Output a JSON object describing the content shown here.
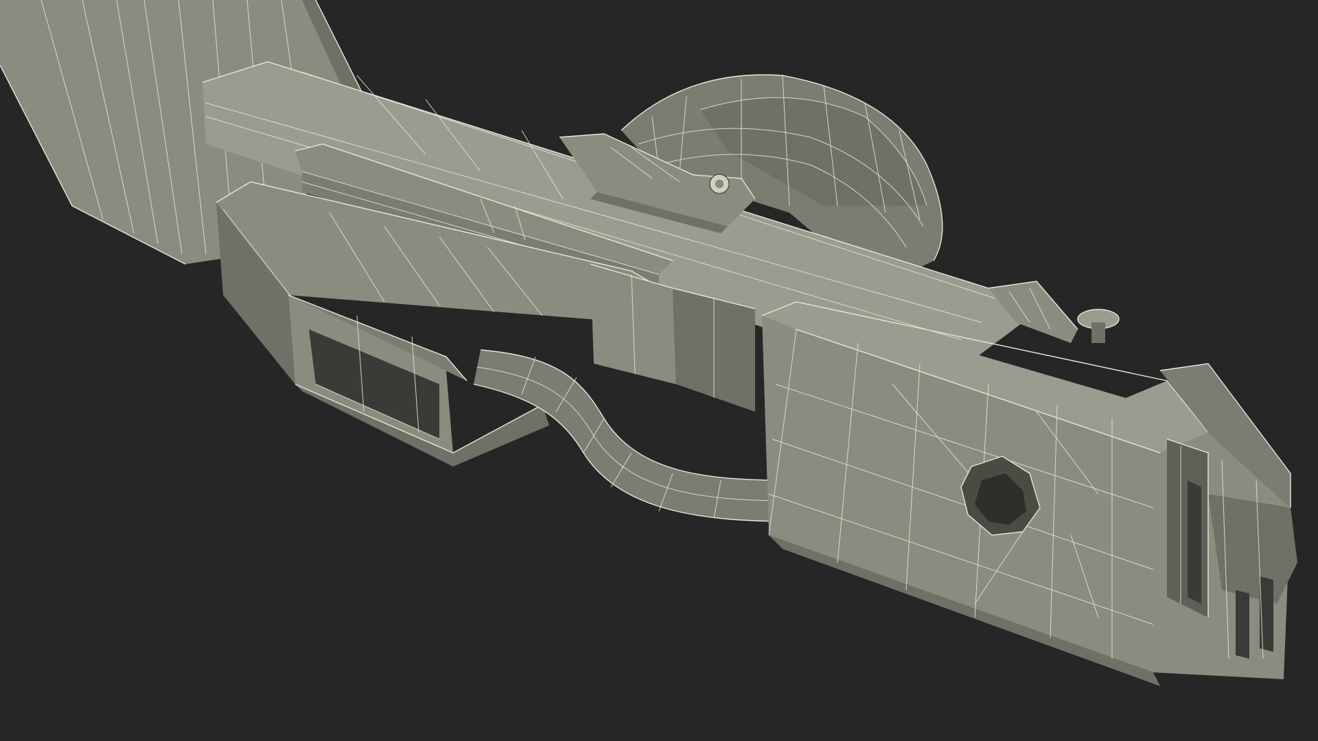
{
  "scene": {
    "subject": "wireframe-3d-model-mechanical-assembly",
    "background_color": "#262626",
    "shading_colors": {
      "light_face": "#9a9c90",
      "mid_face": "#8a8c80",
      "shadow_face": "#6f7166",
      "deep_shadow": "#5e6057",
      "wire": "#e9e8d6"
    }
  }
}
